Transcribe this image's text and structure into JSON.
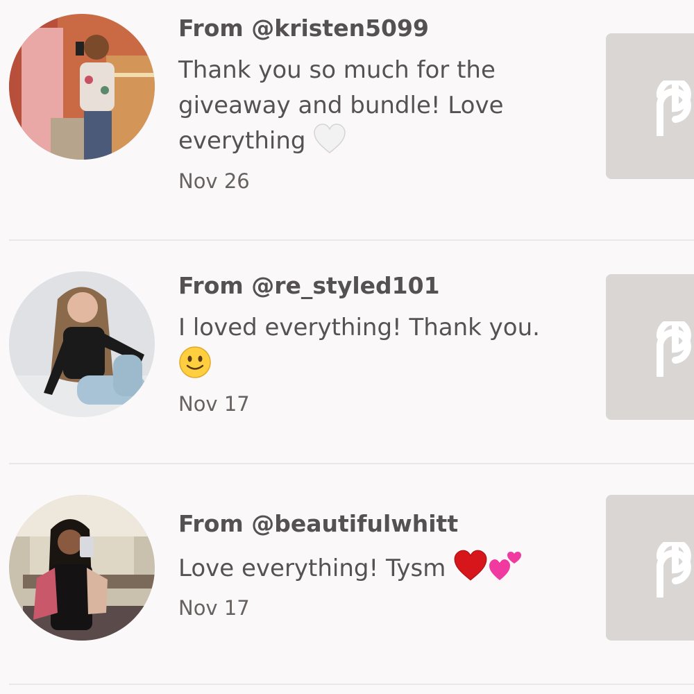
{
  "notifications": [
    {
      "from": "From @kristen5099",
      "message": "Thank you so much for the giveaway and bundle! Love everything",
      "emojis": [
        "white-heart"
      ],
      "date": "Nov 26"
    },
    {
      "from": "From @re_styled101",
      "message": "I loved everything! Thank you.",
      "emojis": [
        "slightly-smiling-face"
      ],
      "date": "Nov 17"
    },
    {
      "from": "From @beautifulwhitt",
      "message": "Love everything! Tysm",
      "emojis": [
        "red-heart",
        "two-hearts"
      ],
      "date": "Nov 17"
    }
  ],
  "colors": {
    "background": "#faf8f9",
    "thumbnail_placeholder": "#d9d6d4",
    "divider": "#ebe6e8",
    "text": "#565152"
  },
  "icons": {
    "thumbnail": "poshmark-logo-icon"
  }
}
